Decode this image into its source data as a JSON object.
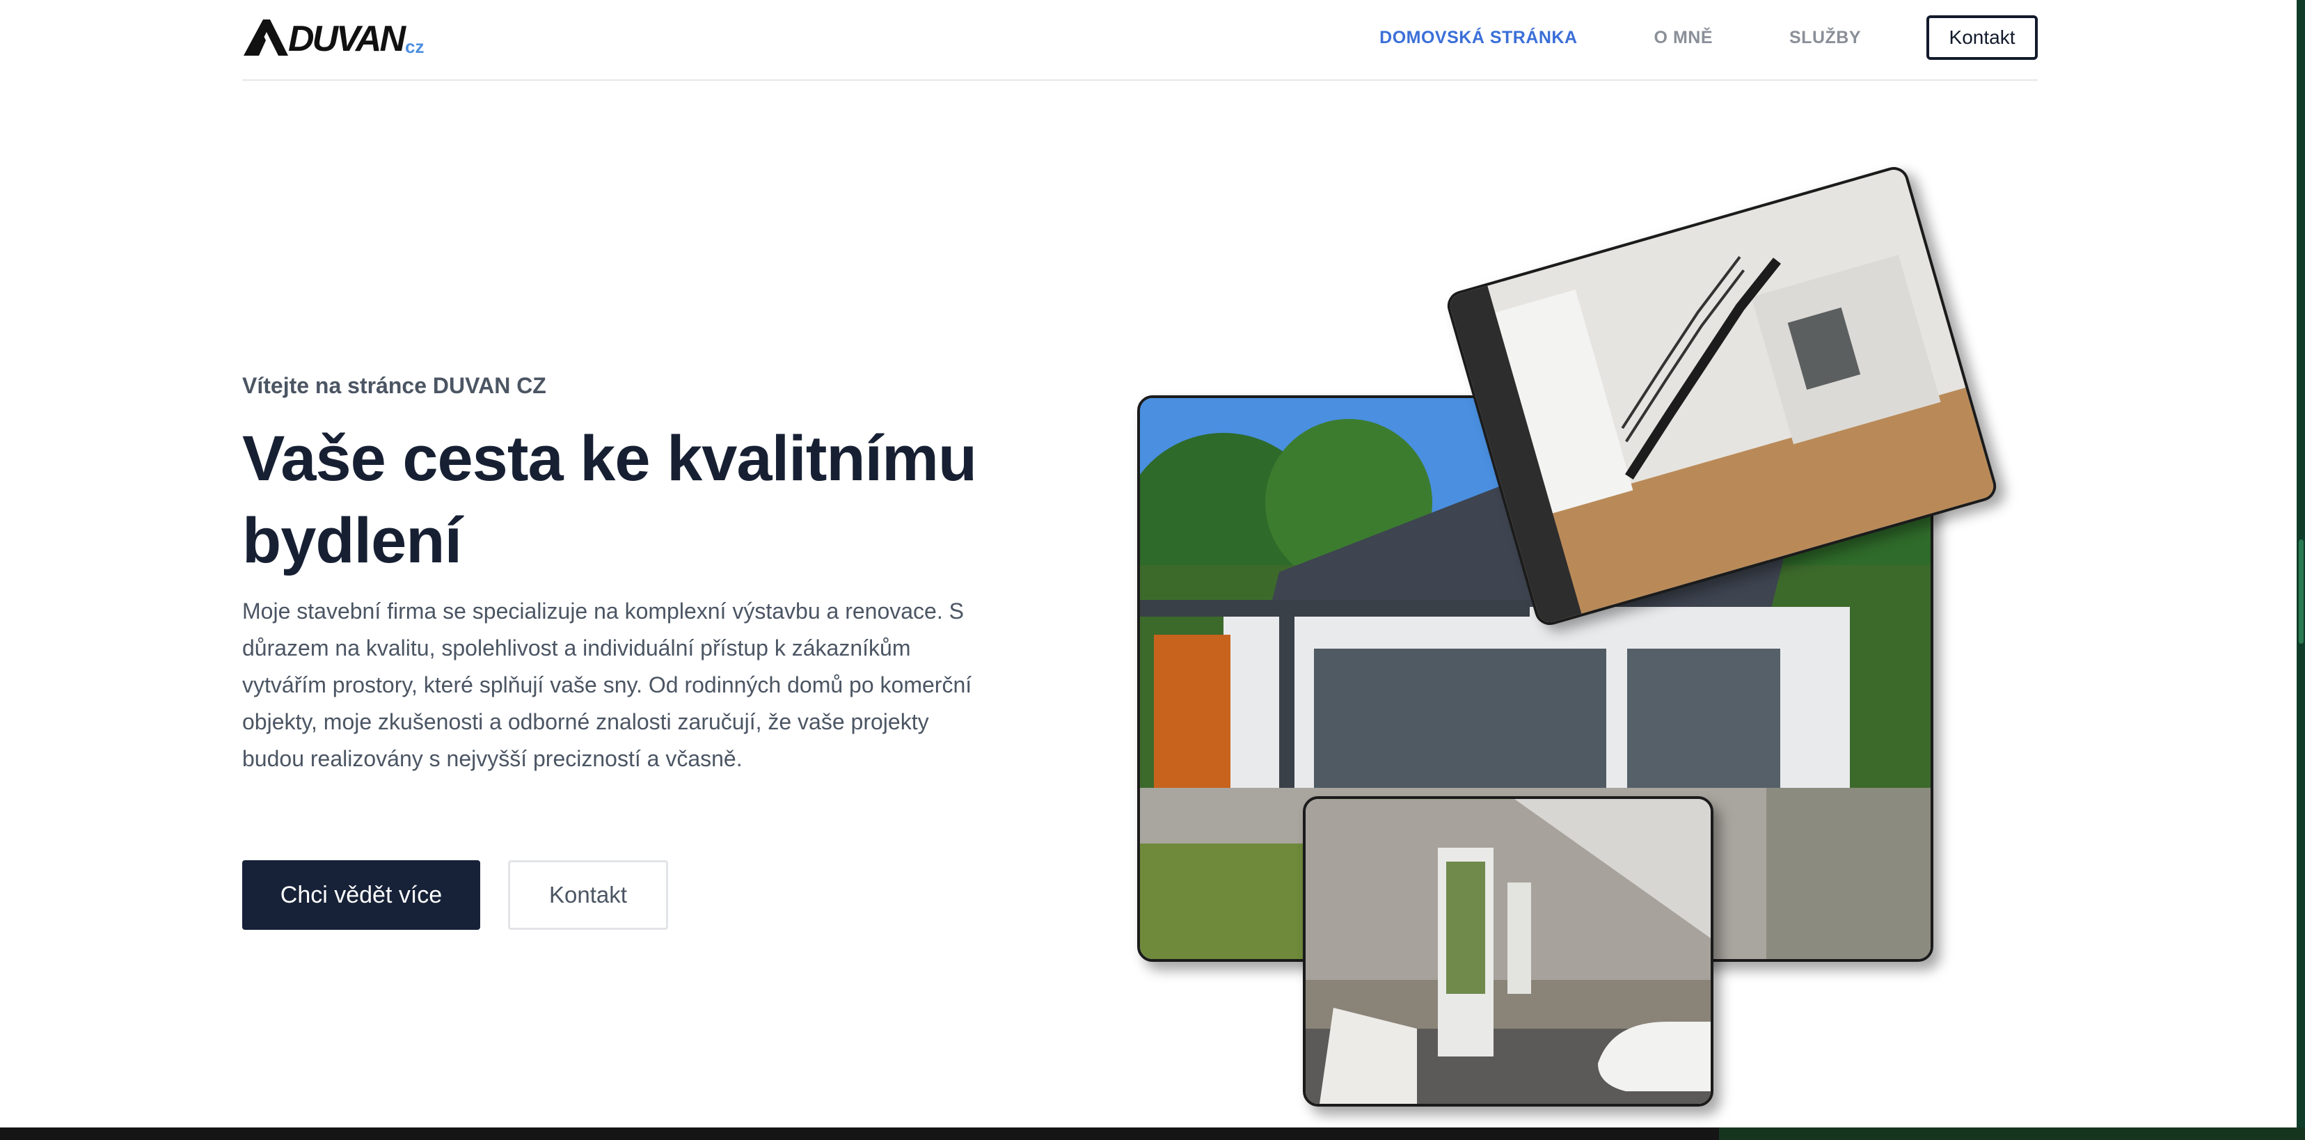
{
  "brand": {
    "logo_text": "DUVAN",
    "logo_suffix": "cz",
    "accent_color": "#4b8fe0",
    "dark_color": "#172238"
  },
  "nav": {
    "items": [
      {
        "label": "DOMOVSKÁ STRÁNKA",
        "active": true
      },
      {
        "label": "O MNĚ",
        "active": false
      },
      {
        "label": "SLUŽBY",
        "active": false
      }
    ],
    "cta_label": "Kontakt"
  },
  "hero": {
    "eyebrow": "Vítejte na stránce DUVAN CZ",
    "headline_line1": "Vaše cesta ke kvalitnímu",
    "headline_line2": "bydlení",
    "lead": "Moje stavební firma se specializuje na komplexní výstavbu a renovace. S důrazem na kvalitu, spolehlivost a individuální přístup k zákazníkům vytvářím prostory, které splňují vaše sny. Od rodinných domů po komerční objekty, moje zkušenosti a odborné znalosti zaručují, že vaše projekty budou realizovány s nejvyšší precizností a včasně.",
    "primary_button": "Chci vědět více",
    "secondary_button": "Kontakt"
  },
  "gallery": {
    "photos": [
      "house-exterior-photo",
      "staircase-interior-photo",
      "bathroom-photo"
    ]
  }
}
